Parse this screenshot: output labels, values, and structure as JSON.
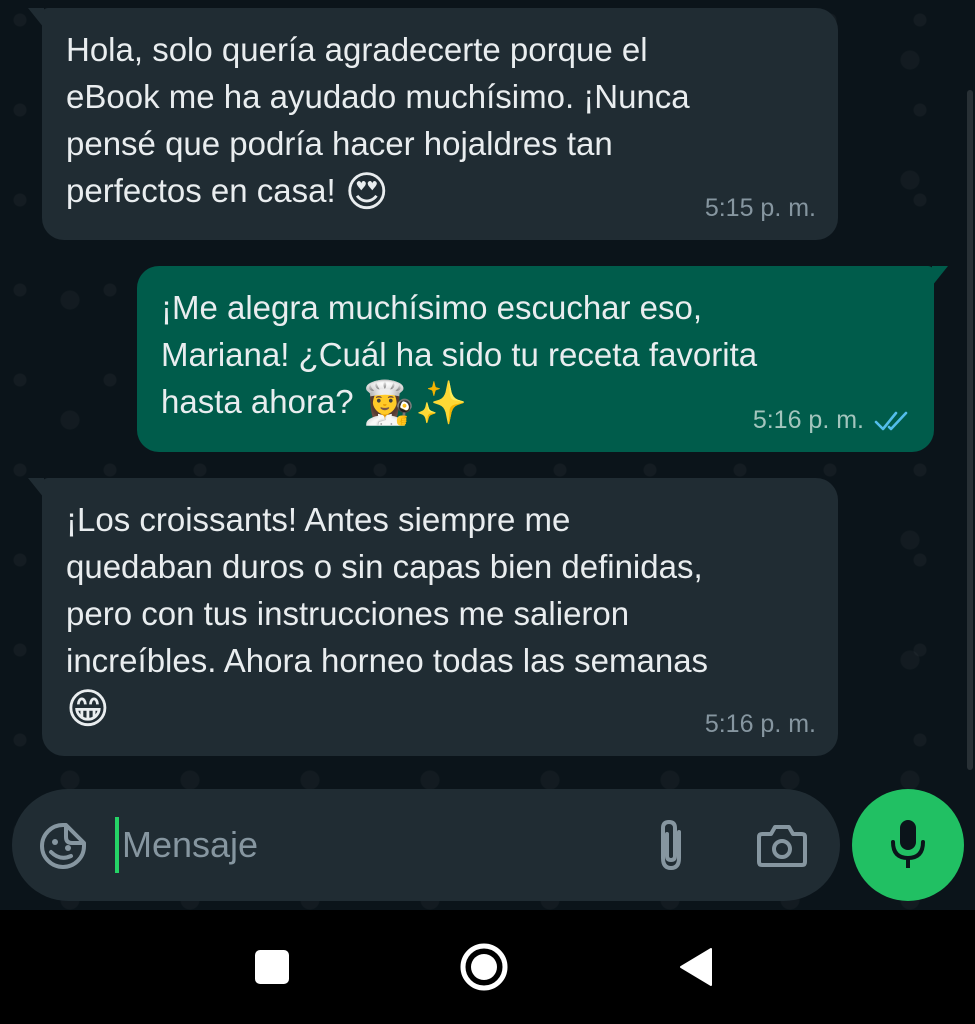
{
  "messages": [
    {
      "direction": "incoming",
      "text": "Hola, solo quería agradecerte porque el\neBook me ha ayudado muchísimo. ¡Nunca\npensé que podría hacer hojaldres tan\nperfectos en casa! ",
      "emoji": "😍",
      "time": "5:15 p. m."
    },
    {
      "direction": "outgoing",
      "text": "¡Me alegra muchísimo escuchar eso,\nMariana! ¿Cuál ha sido tu receta favorita\nhasta ahora? ",
      "emoji": "👩‍🍳✨",
      "time": "5:16 p. m.",
      "status": "read"
    },
    {
      "direction": "incoming",
      "text": "¡Los croissants! Antes siempre me\nquedaban duros o sin capas bien definidas,\npero con tus instrucciones me salieron\nincreíbles. Ahora horneo todas las semanas\n",
      "emoji": "😁",
      "time": "5:16 p. m."
    }
  ],
  "composer": {
    "placeholder": "Mensaje",
    "emoji_icon": "sticker-smiley-icon",
    "attach_icon": "paperclip-icon",
    "camera_icon": "camera-icon",
    "mic_icon": "microphone-icon"
  },
  "nav": {
    "recents_icon": "square-recents-icon",
    "home_icon": "circle-home-icon",
    "back_icon": "triangle-back-icon"
  },
  "colors": {
    "background": "#0b141a",
    "incoming_bubble": "#202c33",
    "outgoing_bubble": "#005c4b",
    "accent_green": "#21c063",
    "read_ticks": "#53bdeb"
  }
}
